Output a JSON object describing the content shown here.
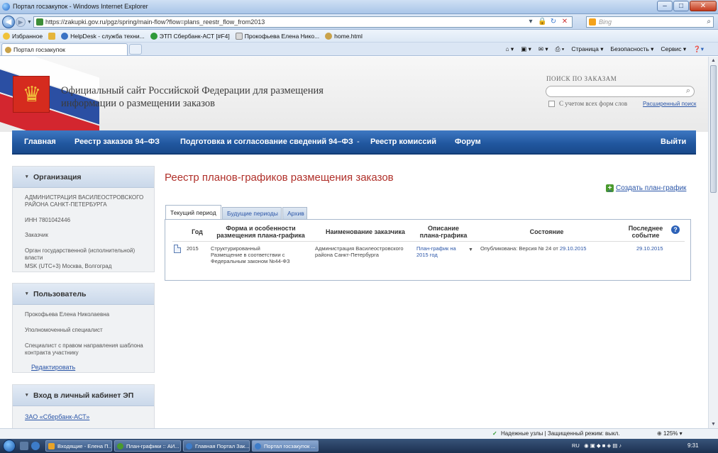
{
  "browser": {
    "window_title": "Портал госзакупок - Windows Internet Explorer",
    "url": "https://zakupki.gov.ru/pgz/spring/main-flow?flow=plans_reestr_flow_from2013",
    "search_placeholder": "Bing",
    "favorites": {
      "label": "Избранное",
      "items": [
        "HelpDesk - служба техни...",
        "ЭТП Сбербанк-АСТ [#F4]",
        "Прокофьева Елена Нико...",
        "home.html"
      ]
    },
    "tab_title": "Портал госзакупок",
    "commands": [
      "Страница ▾",
      "Безопасность ▾",
      "Сервис ▾"
    ]
  },
  "header": {
    "site_title_line1": "Официальный сайт Российской Федерации для размещения",
    "site_title_line2": "информации о размещении заказов",
    "search_label": "ПОИСК ПО ЗАКАЗАМ",
    "wordforms_label": "С учетом всех форм слов",
    "advanced_search": "Расширенный поиск"
  },
  "nav": {
    "home": "Главная",
    "registry_94": "Реестр заказов 94–ФЗ",
    "prep": "Подготовка и согласование сведений 94–ФЗ",
    "separator": "-",
    "commissions": "Реестр комиссий",
    "forum": "Форум",
    "logout": "Выйти"
  },
  "sidebar": {
    "org": {
      "title": "Организация",
      "name_line1": "АДМИНИСТРАЦИЯ ВАСИЛЕОСТРОВСКОГО",
      "name_line2": "РАЙОНА САНКТ-ПЕТЕРБУРГА",
      "inn": "ИНН 7801042446",
      "role": "Заказчик",
      "type": "Орган государственной (исполнительной) власти",
      "timezone": "MSK (UTC+3) Москва, Волгоград"
    },
    "user": {
      "title": "Пользователь",
      "name": "Прокофьева Елена Николаевна",
      "position": "Уполномоченный специалист",
      "right_line1": "Специалист с правом направления шаблона",
      "right_line2": "контракта участнику",
      "edit": "Редактировать"
    },
    "cabinet": {
      "title": "Вход в личный кабинет ЭП",
      "link": "ЗАО «Сбербанк-АСТ»"
    }
  },
  "main": {
    "title": "Реестр планов-графиков размещения заказов",
    "create": "Создать план-график",
    "tabs": [
      "Текущий период",
      "Будущие периоды",
      "Архив"
    ],
    "columns": {
      "year": "Год",
      "form_line1": "Форма и особенности",
      "form_line2": "размещения плана-графика",
      "customer": "Наименование заказчика",
      "desc_line1": "Описание",
      "desc_line2": "плана-графика",
      "state": "Состояние",
      "last_line1": "Последнее",
      "last_line2": "событие"
    },
    "rows": [
      {
        "year": "2015",
        "form_line1": "Структурированный",
        "form_line2": "Размещение в соответствии с",
        "form_line3": "Федеральным законом №44-ФЗ",
        "customer_line1": "Администрация Василеостровского",
        "customer_line2": "района Санкт-Петербурга",
        "desc_line1": "План-график на",
        "desc_line2": "2015 год",
        "state_prefix": "Опубликована: Версия №  24 от",
        "state_date": "29.10.2015",
        "last_event": "29.10.2015"
      }
    ]
  },
  "status": {
    "safe": "Надежные узлы | Защищенный режим: выкл.",
    "zoom": "125%"
  },
  "taskbar": {
    "buttons": [
      "Входящие - Елена П...",
      "План-графики :: АИ...",
      "Главная Портал Зак...",
      "Портал госзакупок ..."
    ],
    "lang": "RU",
    "time": "9:31"
  },
  "colors": {
    "nav_blue": "#20569e",
    "title_red": "#b0302a",
    "link_blue": "#2b56a8"
  }
}
